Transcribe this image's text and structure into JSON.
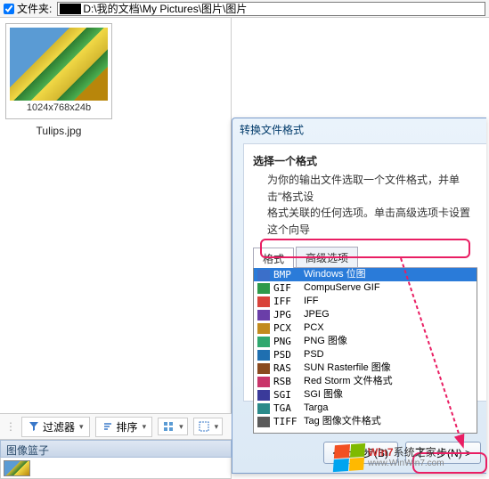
{
  "topbar": {
    "folder_label": "文件夹:",
    "path": "D:\\我的文档\\My Pictures\\图片\\图片"
  },
  "thumbnail": {
    "dimensions": "1024x768x24b",
    "filename": "Tulips.jpg"
  },
  "dialog": {
    "title": "转换文件格式",
    "section_title": "选择一个格式",
    "section_desc_1": "为你的输出文件选取一个文件格式，并单击\"格式设",
    "section_desc_2": "格式关联的任何选项。单击高级选项卡设置这个向导",
    "tabs": {
      "format": "格式",
      "advanced": "高级选项"
    },
    "formats": [
      {
        "ext": "BMP",
        "desc": "Windows 位图",
        "icon_bg": "#3b6fc9",
        "selected": true
      },
      {
        "ext": "GIF",
        "desc": "CompuServe GIF",
        "icon_bg": "#2e9a4a",
        "selected": false
      },
      {
        "ext": "IFF",
        "desc": "IFF",
        "icon_bg": "#d9433a",
        "selected": false
      },
      {
        "ext": "JPG",
        "desc": "JPEG",
        "icon_bg": "#6a3ea8",
        "selected": false
      },
      {
        "ext": "PCX",
        "desc": "PCX",
        "icon_bg": "#c28b1f",
        "selected": false
      },
      {
        "ext": "PNG",
        "desc": "PNG 图像",
        "icon_bg": "#2fa86f",
        "selected": false
      },
      {
        "ext": "PSD",
        "desc": "PSD",
        "icon_bg": "#1f6fb0",
        "selected": false
      },
      {
        "ext": "RAS",
        "desc": "SUN Rasterfile 图像",
        "icon_bg": "#8a4a1f",
        "selected": false
      },
      {
        "ext": "RSB",
        "desc": "Red Storm 文件格式",
        "icon_bg": "#c9356a",
        "selected": false
      },
      {
        "ext": "SGI",
        "desc": "SGI 图像",
        "icon_bg": "#3a3a9a",
        "selected": false
      },
      {
        "ext": "TGA",
        "desc": "Targa",
        "icon_bg": "#2a8a8a",
        "selected": false
      },
      {
        "ext": "TIFF",
        "desc": "Tag 图像文件格式",
        "icon_bg": "#5a5a5a",
        "selected": false
      }
    ],
    "buttons": {
      "back": "< 上一步(B)",
      "next": "下一步(N) >"
    }
  },
  "toolbar": {
    "filter": "过滤器",
    "sort": "排序"
  },
  "basket": {
    "title": "图像篮子"
  },
  "watermark": {
    "line1_a": "Win",
    "line1_b": "7",
    "line1_c": "系统之家",
    "line2": "www.WinWin7.com"
  }
}
